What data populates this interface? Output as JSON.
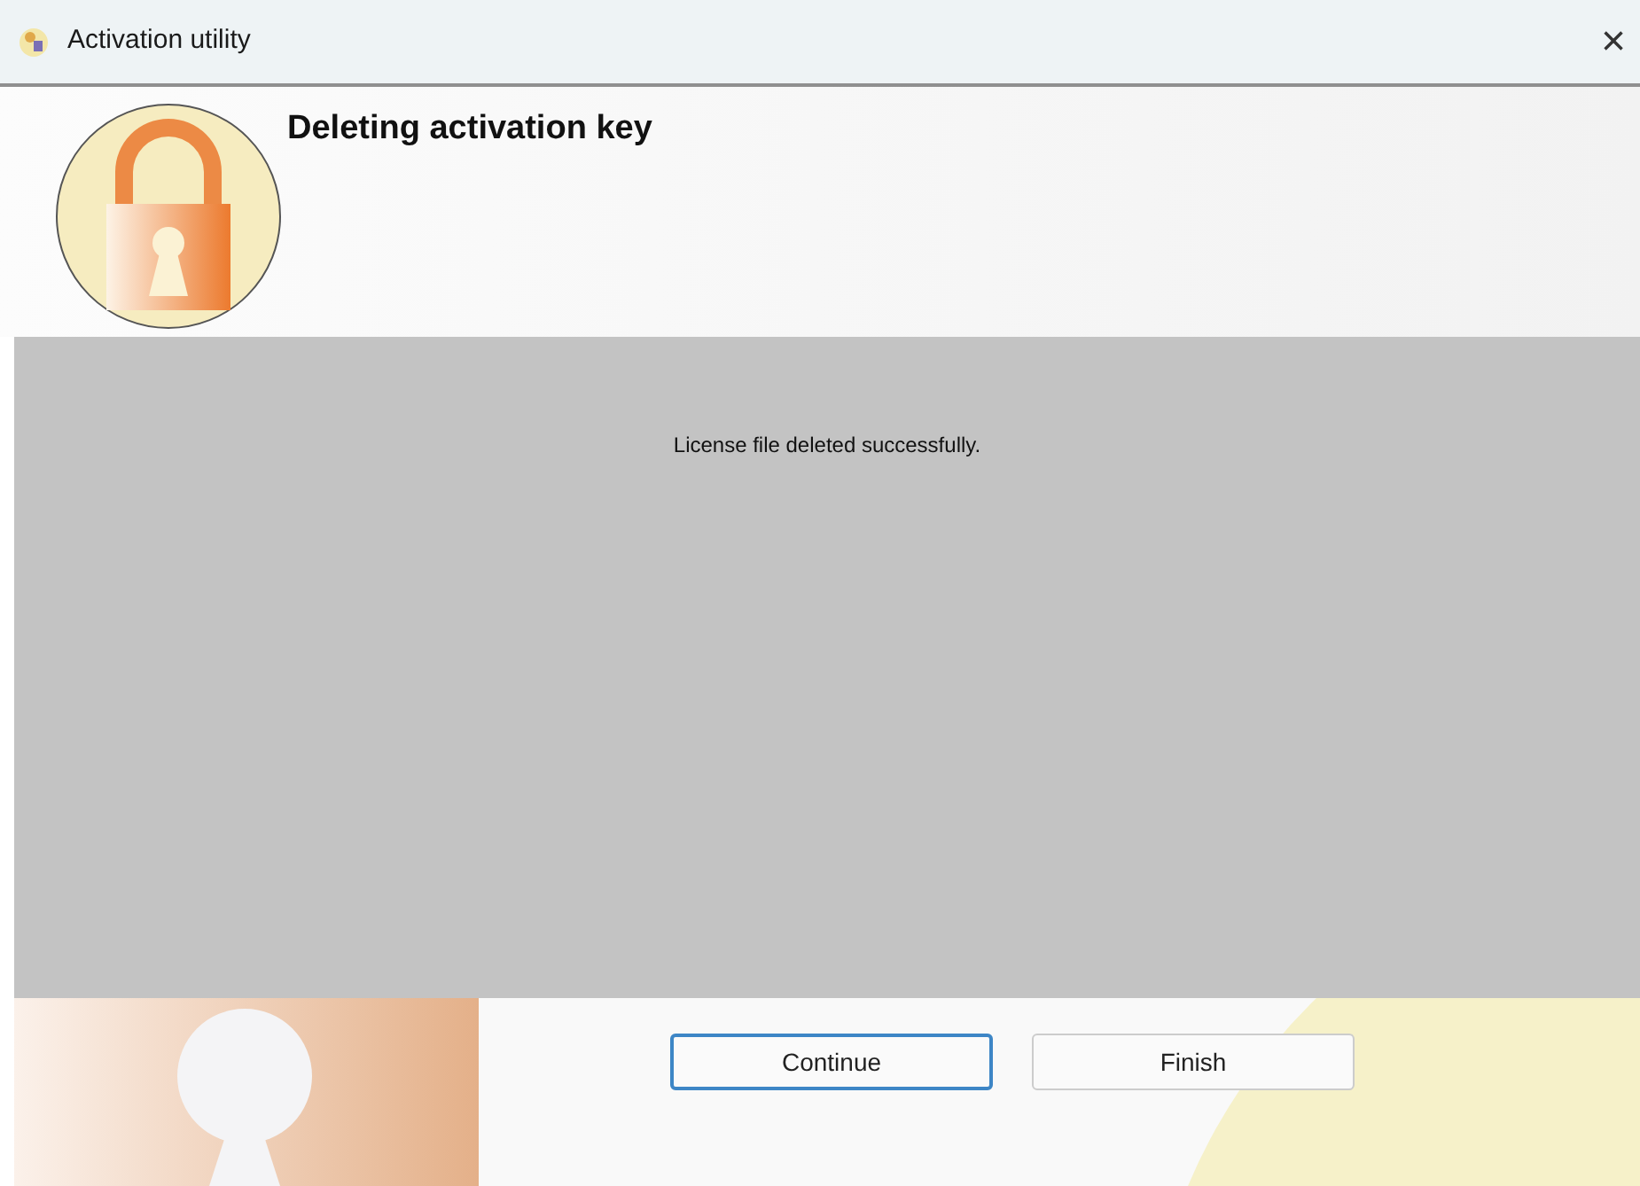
{
  "window": {
    "title": "Activation utility",
    "close": "×"
  },
  "header": {
    "title": "Deleting activation key"
  },
  "message": "License file deleted successfully.",
  "buttons": [
    {
      "label": "Continue",
      "focused": true
    },
    {
      "label": "Finish",
      "focused": false
    }
  ]
}
